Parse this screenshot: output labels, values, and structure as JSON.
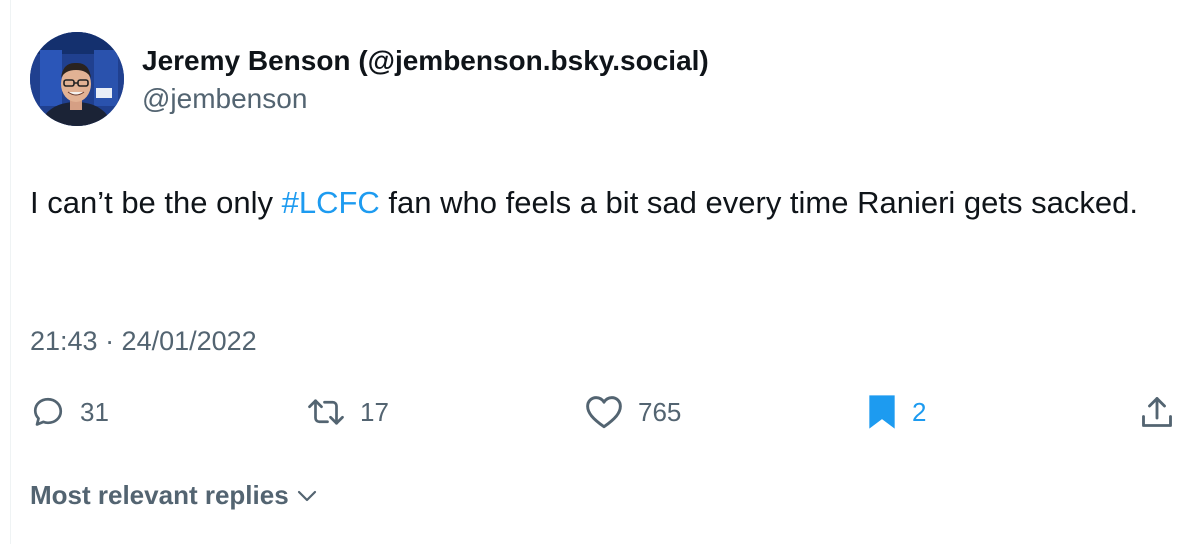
{
  "author": {
    "display_name": "Jeremy Benson (@jembenson.bsky.social)",
    "handle": "@jembenson"
  },
  "tweet": {
    "text_before": "I can’t be the only ",
    "hashtag": "#LCFC",
    "text_after": " fan who feels a bit sad every time Ranieri gets sacked.",
    "hashtag_color": "#1d9bf0"
  },
  "meta": {
    "timestamp": "21:43 · 24/01/2022"
  },
  "actions": {
    "replies": "31",
    "retweets": "17",
    "likes": "765",
    "bookmarks": "2",
    "reply_icon": "reply-icon",
    "retweet_icon": "retweet-icon",
    "like_icon": "heart-icon",
    "bookmark_icon": "bookmark-icon",
    "share_icon": "share-icon",
    "bookmark_active_color": "#1d9bf0"
  },
  "replies_sort": {
    "label": "Most relevant replies",
    "icon": "chevron-down-icon"
  },
  "colors": {
    "text_primary": "#0f1419",
    "text_secondary": "#536471",
    "accent": "#1d9bf0"
  }
}
